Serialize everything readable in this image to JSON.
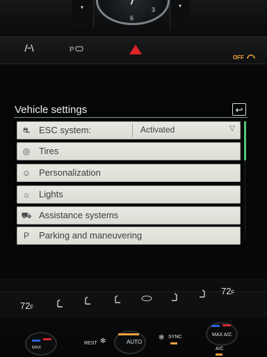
{
  "dashboard": {
    "clock_numerals": [
      "3",
      "6"
    ],
    "vent_left_glyph": "▾",
    "vent_right_glyph": "▾",
    "switch_icons": [
      "parking-assist-icon",
      "park-distance-icon",
      "hazard-icon"
    ],
    "off_label": "OFF"
  },
  "screen": {
    "title": "Vehicle settings",
    "back_icon": "↩",
    "items": [
      {
        "icon": "esc-icon",
        "glyph": "⛐",
        "label": "ESC system:",
        "value": "Activated",
        "dropdown": "▽"
      },
      {
        "icon": "tire-icon",
        "glyph": "◎",
        "label": "Tires"
      },
      {
        "icon": "person-icon",
        "glyph": "☺",
        "label": "Personalization"
      },
      {
        "icon": "light-icon",
        "glyph": "☼",
        "label": "Lights"
      },
      {
        "icon": "assistance-icon",
        "glyph": "⛟",
        "label": "Assistance systems"
      },
      {
        "icon": "parking-icon",
        "glyph": "P",
        "label": "Parking and maneuvering"
      }
    ]
  },
  "climate": {
    "left_temp": "72",
    "left_unit": "F",
    "right_temp": "72",
    "right_unit": "F",
    "rest_label": "REST",
    "auto_label": "AUTO",
    "sync_label": "SYNC",
    "max_ac_label": "MAX A/C",
    "ac_label": "A/C",
    "max_label": "MAX"
  },
  "colors": {
    "accent_green": "#4fc87a",
    "hazard_red": "#e0222a",
    "amber": "#f2a23a",
    "row_bg": "#e4e4de"
  }
}
